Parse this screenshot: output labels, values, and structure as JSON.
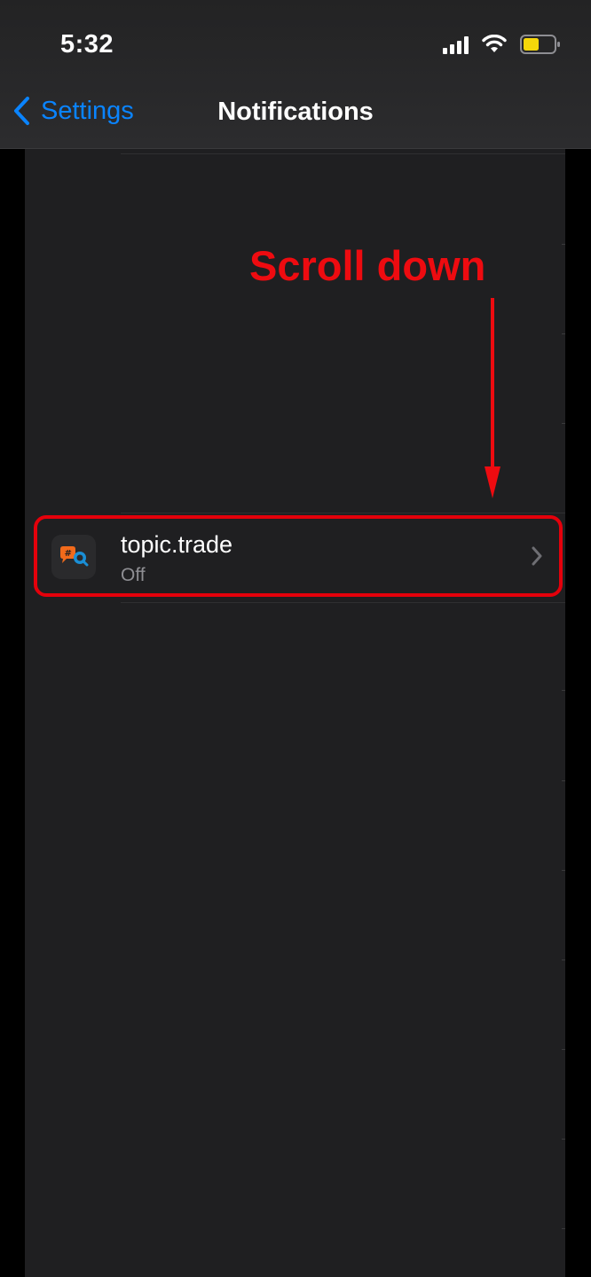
{
  "status_bar": {
    "time": "5:32",
    "icons": [
      "signal-icon",
      "wifi-icon",
      "battery-icon"
    ],
    "battery_color": "#f5d70a"
  },
  "nav": {
    "back_label": "Settings",
    "title": "Notifications",
    "accent_color": "#0a84ff"
  },
  "app_row": {
    "name": "topic.trade",
    "status": "Off",
    "icon": "topic-trade-app-icon"
  },
  "annotation": {
    "text": "Scroll down",
    "color": "#ee0b10"
  }
}
